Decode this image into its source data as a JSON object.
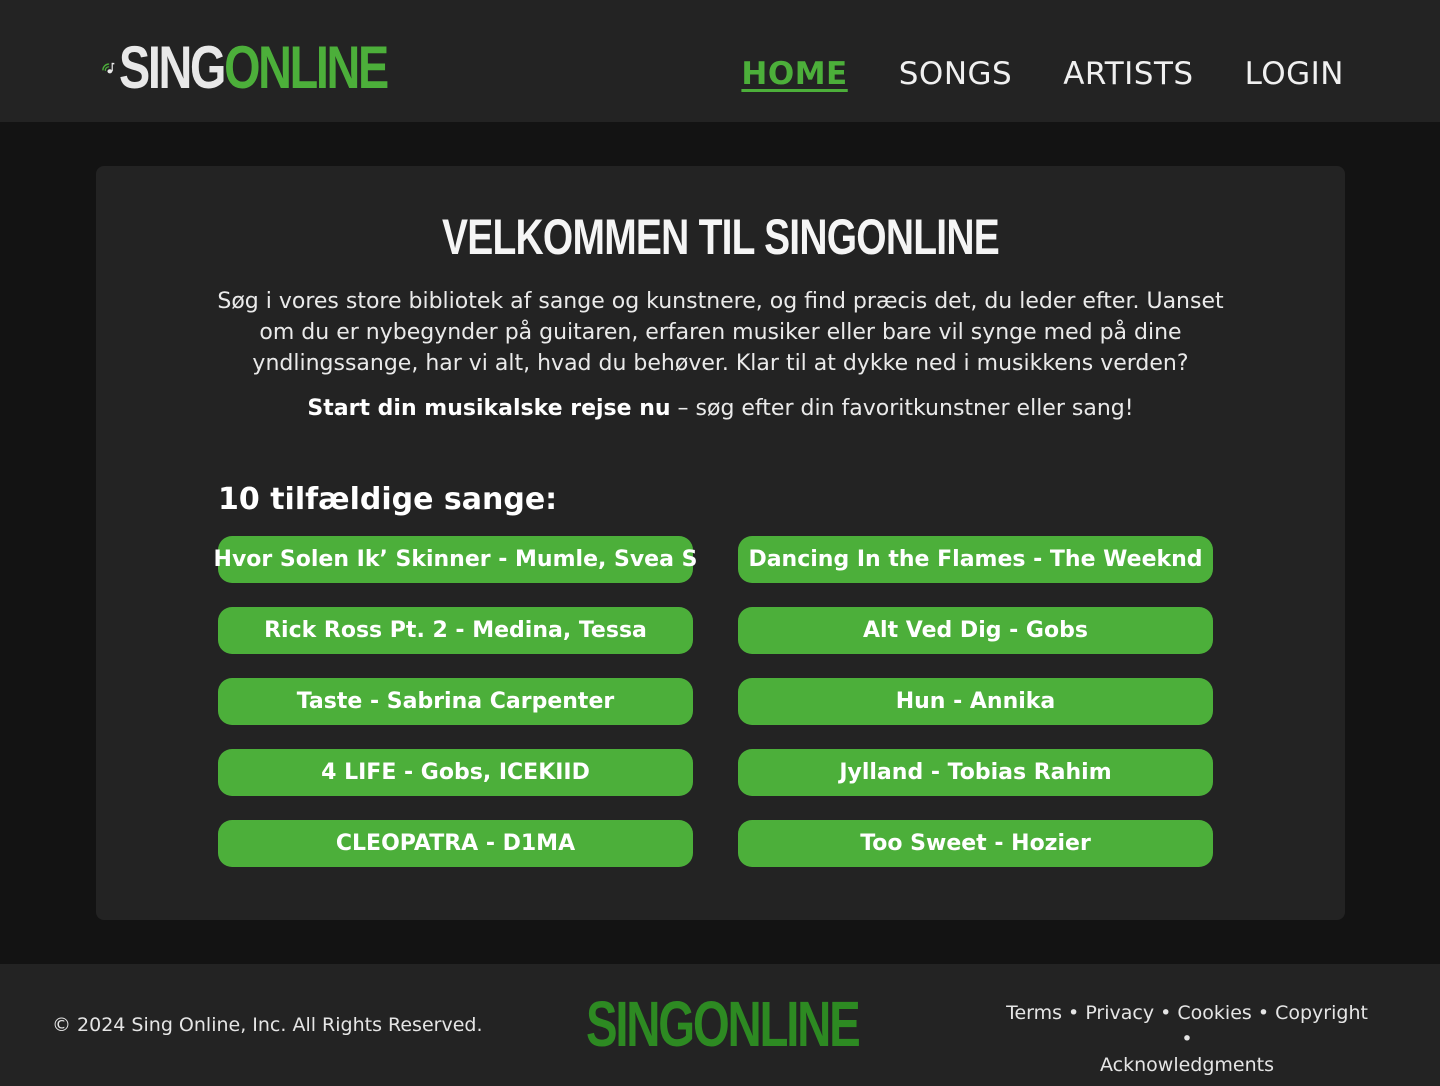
{
  "header": {
    "logo": {
      "part1": "SING",
      "part2": "ONLINE"
    },
    "nav": [
      {
        "label": "HOME",
        "active": true
      },
      {
        "label": "SONGS",
        "active": false
      },
      {
        "label": "ARTISTS",
        "active": false
      },
      {
        "label": "LOGIN",
        "active": false
      }
    ]
  },
  "main": {
    "title_prefix": "VELKOMMEN TIL ",
    "title_suffix": "SINGONLINE",
    "intro": "Søg i vores store bibliotek af sange og kunstnere, og find præcis det, du leder efter. Uanset om du er nybegynder på guitaren, erfaren musiker eller bare vil synge med på dine yndlingssange, har vi alt, hvad du behøver. Klar til at dykke ned i musikkens verden?",
    "cta_bold": "Start din musikalske rejse nu",
    "cta_rest": " – søg efter din favoritkunstner eller sang!",
    "songs_heading": "10 tilfældige sange:",
    "songs": [
      "Hvor Solen Ik’ Skinner - Mumle, Svea S",
      "Dancing In the Flames - The Weeknd",
      "Rick Ross Pt. 2 - Medina, Tessa",
      "Alt Ved Dig - Gobs",
      "Taste - Sabrina Carpenter",
      "Hun - Annika",
      "4 LIFE - Gobs, ICEKIID",
      "Jylland - Tobias Rahim",
      "CLEOPATRA - D1MA",
      "Too Sweet - Hozier"
    ]
  },
  "footer": {
    "copyright": "© 2024 Sing Online, Inc. All Rights Reserved.",
    "logo": "SINGONLINE",
    "links": [
      "Terms",
      "Privacy",
      "Cookies",
      "Copyright",
      "Acknowledgments"
    ],
    "separator": " • "
  },
  "colors": {
    "accent": "#4caf3a",
    "footer_logo": "#2d8a22",
    "background": "#131313",
    "panel": "#232323"
  },
  "icons": {
    "logo_icon": "music-note-with-signal-waves-icon"
  }
}
